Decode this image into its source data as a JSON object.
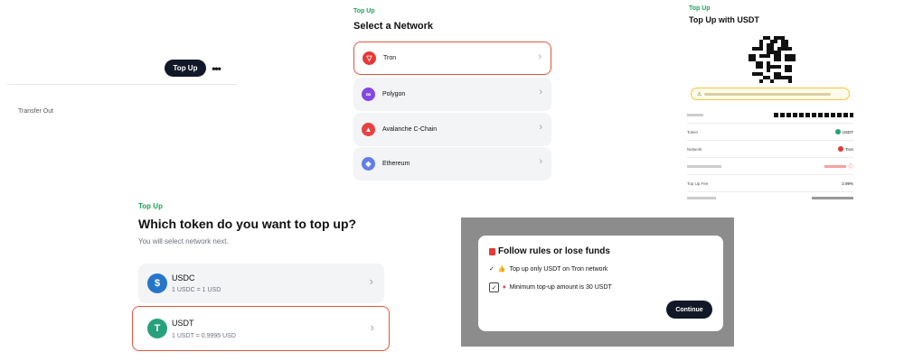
{
  "panel1": {
    "topup_label": "Top Up",
    "more": "•••",
    "transfer_out": "Transfer Out"
  },
  "panel2": {
    "eyebrow": "Top Up",
    "title": "Select a Network",
    "networks": [
      {
        "label": "Tron",
        "selected": true,
        "color": "#e53935"
      },
      {
        "label": "Polygon",
        "selected": false,
        "color": "#8247e5"
      },
      {
        "label": "Avalanche C-Chain",
        "selected": false,
        "color": "#e84142"
      },
      {
        "label": "Ethereum",
        "selected": false,
        "color": "#627eea"
      }
    ],
    "chevron": "›"
  },
  "panel3": {
    "eyebrow": "Top Up",
    "title": "Top Up with USDT",
    "rows": [
      {
        "label": "Token",
        "value": "USDT"
      },
      {
        "label": "Network",
        "value": "Tron"
      },
      {
        "label": "Top Up Fee",
        "value": "2.99%"
      }
    ]
  },
  "panel4": {
    "eyebrow": "Top Up",
    "title": "Which token do you want to top up?",
    "subtitle": "You will select network next.",
    "tokens": [
      {
        "name": "USDC",
        "rate": "1 USDC = 1 USD",
        "color": "#2775ca",
        "selected": false
      },
      {
        "name": "USDT",
        "rate": "1 USDT = 0.9995 USD",
        "color": "#26a17b",
        "selected": true
      }
    ],
    "chevron": "›"
  },
  "panel5": {
    "title": "Follow rules or lose funds",
    "rule1": "Top up only USDT on Tron network",
    "rule2": "Minimum top-up amount is 30 USDT",
    "continue_label": "Continue"
  },
  "colors": {
    "accent_green": "#22a35a",
    "selection_border": "#e7553b",
    "dark_button": "#111827"
  }
}
